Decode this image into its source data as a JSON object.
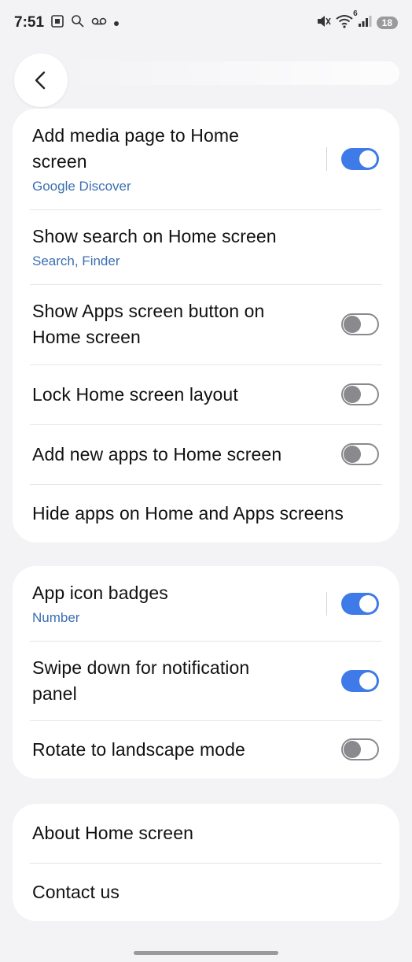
{
  "status_bar": {
    "time": "7:51",
    "left_icons": [
      "screenshot-icon",
      "search-assist-icon",
      "voicemail-icon",
      "dot-icon"
    ],
    "right_icons": [
      "mute-vibrate-icon",
      "wifi-icon",
      "signal-icon"
    ],
    "wifi_label": "6",
    "battery": "18"
  },
  "colors": {
    "accent": "#3f7be8",
    "subtitle": "#3a6fb3",
    "background": "#f3f3f6",
    "card": "#ffffff"
  },
  "card1": {
    "rows": [
      {
        "title": "Add media page to Home screen",
        "subtitle": "Google Discover",
        "toggle": "on"
      },
      {
        "title": "Show search on Home screen",
        "subtitle": "Search, Finder"
      },
      {
        "title": "Show Apps screen button on Home screen",
        "toggle": "off"
      },
      {
        "title": "Lock Home screen layout",
        "toggle": "off"
      },
      {
        "title": "Add new apps to Home screen",
        "toggle": "off"
      },
      {
        "title": "Hide apps on Home and Apps screens"
      }
    ]
  },
  "card2": {
    "rows": [
      {
        "title": "App icon badges",
        "subtitle": "Number",
        "toggle": "on"
      },
      {
        "title": "Swipe down for notification panel",
        "toggle": "on"
      },
      {
        "title": "Rotate to landscape mode",
        "toggle": "off"
      }
    ]
  },
  "card3": {
    "rows": [
      {
        "title": "About Home screen"
      },
      {
        "title": "Contact us"
      }
    ]
  }
}
